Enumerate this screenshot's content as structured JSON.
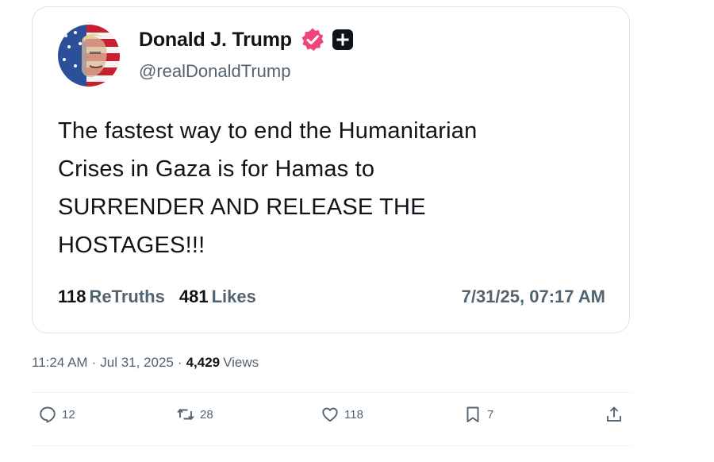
{
  "truth_card": {
    "author_name": "Donald J. Trump",
    "author_handle": "@realDonaldTrump",
    "text_lines": [
      "The fastest way to end the Humanitarian",
      "Crises in Gaza is for Hamas to",
      "SURRENDER AND RELEASE THE",
      "HOSTAGES!!!"
    ],
    "retruths_count": "118",
    "retruths_label": "ReTruths",
    "likes_count": "481",
    "likes_label": "Likes",
    "date": "7/31/25, 07:17 AM",
    "verified_color": "#f0457a"
  },
  "post_meta": {
    "time": "11:24 AM",
    "separator": "·",
    "date": "Jul 31, 2025",
    "views_count": "4,429",
    "views_label": "Views"
  },
  "actions": {
    "replies": "12",
    "reposts": "28",
    "likes": "118",
    "bookmarks": "7"
  },
  "icons": [
    "reply-icon",
    "repost-icon",
    "like-icon",
    "bookmark-icon",
    "share-icon",
    "verified-badge-icon",
    "plus-badge-icon"
  ]
}
